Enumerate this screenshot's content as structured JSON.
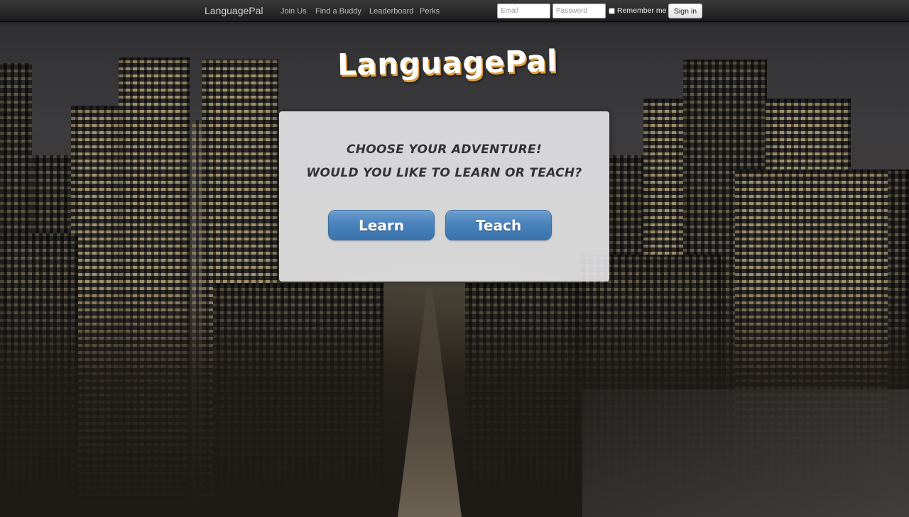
{
  "navbar": {
    "brand": "LanguagePal",
    "links": [
      "Join Us",
      "Find a Buddy",
      "Leaderboard",
      "Perks"
    ],
    "email_placeholder": "Email",
    "password_placeholder": "Password",
    "remember_label": "Remember me",
    "signin_label": "Sign in"
  },
  "hero": {
    "logo": "LanguagePal",
    "headline_1": "Choose your adventure!",
    "headline_2": "Would you like to learn or teach?",
    "learn_label": "Learn",
    "teach_label": "Teach"
  },
  "colors": {
    "navbar": "#222222",
    "button": "#4a82bb",
    "logo_shadow": "#e0a03a"
  }
}
